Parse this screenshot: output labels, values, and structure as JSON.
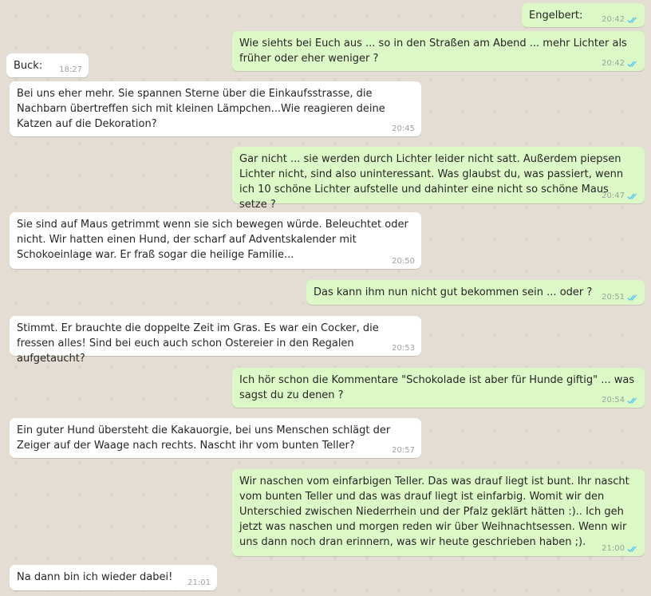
{
  "messages": [
    {
      "dir": "out",
      "text": "Engelbert:",
      "time": "20:42",
      "ticks": "read-ticks-icon"
    },
    {
      "dir": "out",
      "text": "Wie siehts bei Euch aus ... so in den Straßen am Abend ... mehr Lichter als früher oder eher weniger ?",
      "time": "20:42",
      "ticks": "read-ticks-icon"
    },
    {
      "dir": "in",
      "text": "Buck:",
      "time": "18:27"
    },
    {
      "dir": "in",
      "text": "Bei uns eher mehr. Sie spannen Sterne über die Einkaufsstrasse, die Nachbarn übertreffen sich mit kleinen Lämpchen...Wie reagieren deine Katzen auf die Dekoration?",
      "time": "20:45"
    },
    {
      "dir": "out",
      "text": "Gar nicht ... sie werden durch Lichter leider nicht satt. Außerdem piepsen Lichter nicht, sind also uninteressant. Was glaubst du, was passiert, wenn ich 10 schöne Lichter aufstelle und dahinter eine nicht so schöne Maus setze ?",
      "time": "20:47",
      "ticks": "read-ticks-icon"
    },
    {
      "dir": "in",
      "text": "Sie sind auf Maus getrimmt wenn sie sich bewegen würde. Beleuchtet oder nicht. Wir hatten einen Hund, der scharf auf Adventskalender mit Schokoeinlage war. Er fraß sogar die heilige Familie...",
      "time": "20:50"
    },
    {
      "dir": "out",
      "text": "Das kann ihm nun nicht gut bekommen sein ... oder ?",
      "time": "20:51",
      "ticks": "read-ticks-icon"
    },
    {
      "dir": "in",
      "text": "Stimmt. Er brauchte die doppelte Zeit im Gras. Es war ein Cocker, die fressen alles! Sind bei euch auch schon Ostereier in den Regalen aufgetaucht?",
      "time": "20:53"
    },
    {
      "dir": "out",
      "text": "Ich hör schon die Kommentare \"Schokolade ist aber für Hunde giftig\" ... was sagst du zu denen ?",
      "time": "20:54",
      "ticks": "read-ticks-icon"
    },
    {
      "dir": "in",
      "text": "Ein guter Hund übersteht die Kakauorgie, bei uns Menschen schlägt der Zeiger auf der Waage nach rechts. Nascht ihr vom bunten Teller?",
      "time": "20:57"
    },
    {
      "dir": "out",
      "text": "Wir naschen vom einfarbigen Teller. Das was drauf liegt ist bunt. Ihr nascht vom bunten Teller und das was drauf liegt ist einfarbig. Womit wir den Unterschied zwischen Niederrhein und der Pfalz geklärt hätten :).. Ich geh jetzt was naschen und morgen reden wir über Weihnachtsessen. Wenn wir uns dann noch dran erinnern, was wir heute geschrieben haben ;).",
      "time": "21:00",
      "ticks": "read-ticks-icon"
    },
    {
      "dir": "in",
      "text": "Na dann bin ich wieder dabei!",
      "time": "21:01"
    }
  ],
  "colors": {
    "incoming": "#ffffff",
    "outgoing": "#dcf8c6",
    "background": "#e4ddd4",
    "read_ticks": "#4fc3f7"
  }
}
